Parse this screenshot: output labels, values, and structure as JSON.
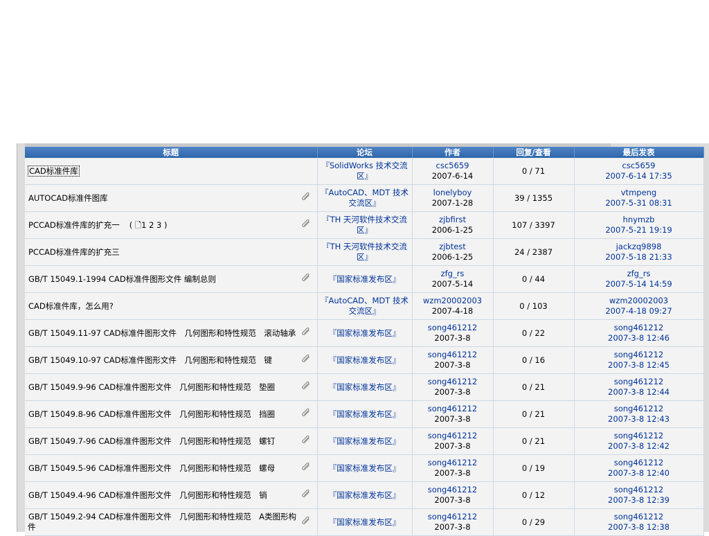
{
  "columns": {
    "title": "标题",
    "forum": "论坛",
    "author": "作者",
    "stats": "回复/查看",
    "last": "最后发表"
  },
  "rows": [
    {
      "title": "CAD标准件库",
      "attachment": false,
      "pages": "",
      "forum": "『SolidWorks 技术交流区』",
      "author": "csc5659",
      "date": "2007-6-14",
      "stats": "0 / 71",
      "last_user": "csc5659",
      "last_time": "2007-6-14 17:35"
    },
    {
      "title": "AUTOCAD标准件图库",
      "attachment": true,
      "pages": "",
      "forum": "『AutoCAD、MDT 技术交流区』",
      "author": "lonelyboy",
      "date": "2007-1-28",
      "stats": "39 / 1355",
      "last_user": "vtmpeng",
      "last_time": "2007-5-31 08:31"
    },
    {
      "title": "PCCAD标准件库的扩充一",
      "attachment": true,
      "pages": "( 🗋1 2 3 )",
      "forum": "『TH 天河软件技术交流区』",
      "author": "zjbfirst",
      "date": "2006-1-25",
      "stats": "107 / 3397",
      "last_user": "hnymzb",
      "last_time": "2007-5-21 19:19"
    },
    {
      "title": "PCCAD标准件库的扩充三",
      "attachment": false,
      "pages": "",
      "forum": "『TH 天河软件技术交流区』",
      "author": "zjbtest",
      "date": "2006-1-25",
      "stats": "24 / 2387",
      "last_user": "jackzq9898",
      "last_time": "2007-5-18 21:33"
    },
    {
      "title": "GB/T 15049.1-1994 CAD标准件图形文件 编制总则",
      "attachment": true,
      "pages": "",
      "forum": "『国家标准发布区』",
      "author": "zfg_rs",
      "date": "2007-5-14",
      "stats": "0 / 44",
      "last_user": "zfg_rs",
      "last_time": "2007-5-14 14:59"
    },
    {
      "title": "CAD标准件库，怎么用?",
      "attachment": false,
      "pages": "",
      "forum": "『AutoCAD、MDT 技术交流区』",
      "author": "wzm20002003",
      "date": "2007-4-18",
      "stats": "0 / 103",
      "last_user": "wzm20002003",
      "last_time": "2007-4-18 09:27"
    },
    {
      "title": "GB/T 15049.11-97 CAD标准件图形文件　几何图形和特性规范　滚动轴承",
      "attachment": true,
      "pages": "",
      "forum": "『国家标准发布区』",
      "author": "song461212",
      "date": "2007-3-8",
      "stats": "0 / 22",
      "last_user": "song461212",
      "last_time": "2007-3-8 12:46"
    },
    {
      "title": "GB/T 15049.10-97 CAD标准件图形文件　几何图形和特性规范　键",
      "attachment": true,
      "pages": "",
      "forum": "『国家标准发布区』",
      "author": "song461212",
      "date": "2007-3-8",
      "stats": "0 / 16",
      "last_user": "song461212",
      "last_time": "2007-3-8 12:45"
    },
    {
      "title": "GB/T 15049.9-96 CAD标准件图形文件　几何图形和特性规范　垫圈",
      "attachment": true,
      "pages": "",
      "forum": "『国家标准发布区』",
      "author": "song461212",
      "date": "2007-3-8",
      "stats": "0 / 21",
      "last_user": "song461212",
      "last_time": "2007-3-8 12:44"
    },
    {
      "title": "GB/T 15049.8-96 CAD标准件图形文件　几何图形和特性规范　挡圈",
      "attachment": true,
      "pages": "",
      "forum": "『国家标准发布区』",
      "author": "song461212",
      "date": "2007-3-8",
      "stats": "0 / 21",
      "last_user": "song461212",
      "last_time": "2007-3-8 12:43"
    },
    {
      "title": "GB/T 15049.7-96 CAD标准件图形文件　几何图形和特性规范　螺钉",
      "attachment": true,
      "pages": "",
      "forum": "『国家标准发布区』",
      "author": "song461212",
      "date": "2007-3-8",
      "stats": "0 / 21",
      "last_user": "song461212",
      "last_time": "2007-3-8 12:42"
    },
    {
      "title": "GB/T 15049.5-96 CAD标准件图形文件　几何图形和特性规范　螺母",
      "attachment": true,
      "pages": "",
      "forum": "『国家标准发布区』",
      "author": "song461212",
      "date": "2007-3-8",
      "stats": "0 / 19",
      "last_user": "song461212",
      "last_time": "2007-3-8 12:40"
    },
    {
      "title": "GB/T 15049.4-96 CAD标准件图形文件　几何图形和特性规范　销",
      "attachment": true,
      "pages": "",
      "forum": "『国家标准发布区』",
      "author": "song461212",
      "date": "2007-3-8",
      "stats": "0 / 12",
      "last_user": "song461212",
      "last_time": "2007-3-8 12:39"
    },
    {
      "title": "GB/T 15049.2-94 CAD标准件图形文件　几何图形和特性规范　A类图形构件",
      "attachment": true,
      "pages": "",
      "forum": "『国家标准发布区』",
      "author": "song461212",
      "date": "2007-3-8",
      "stats": "0 / 29",
      "last_user": "song461212",
      "last_time": "2007-3-8 12:38"
    }
  ],
  "icons": {
    "attachment": "paperclip-icon",
    "pages": "page-icon"
  },
  "colors": {
    "header": "#3a72b8",
    "link": "#003399",
    "row_bg": "#f3f3f3"
  }
}
